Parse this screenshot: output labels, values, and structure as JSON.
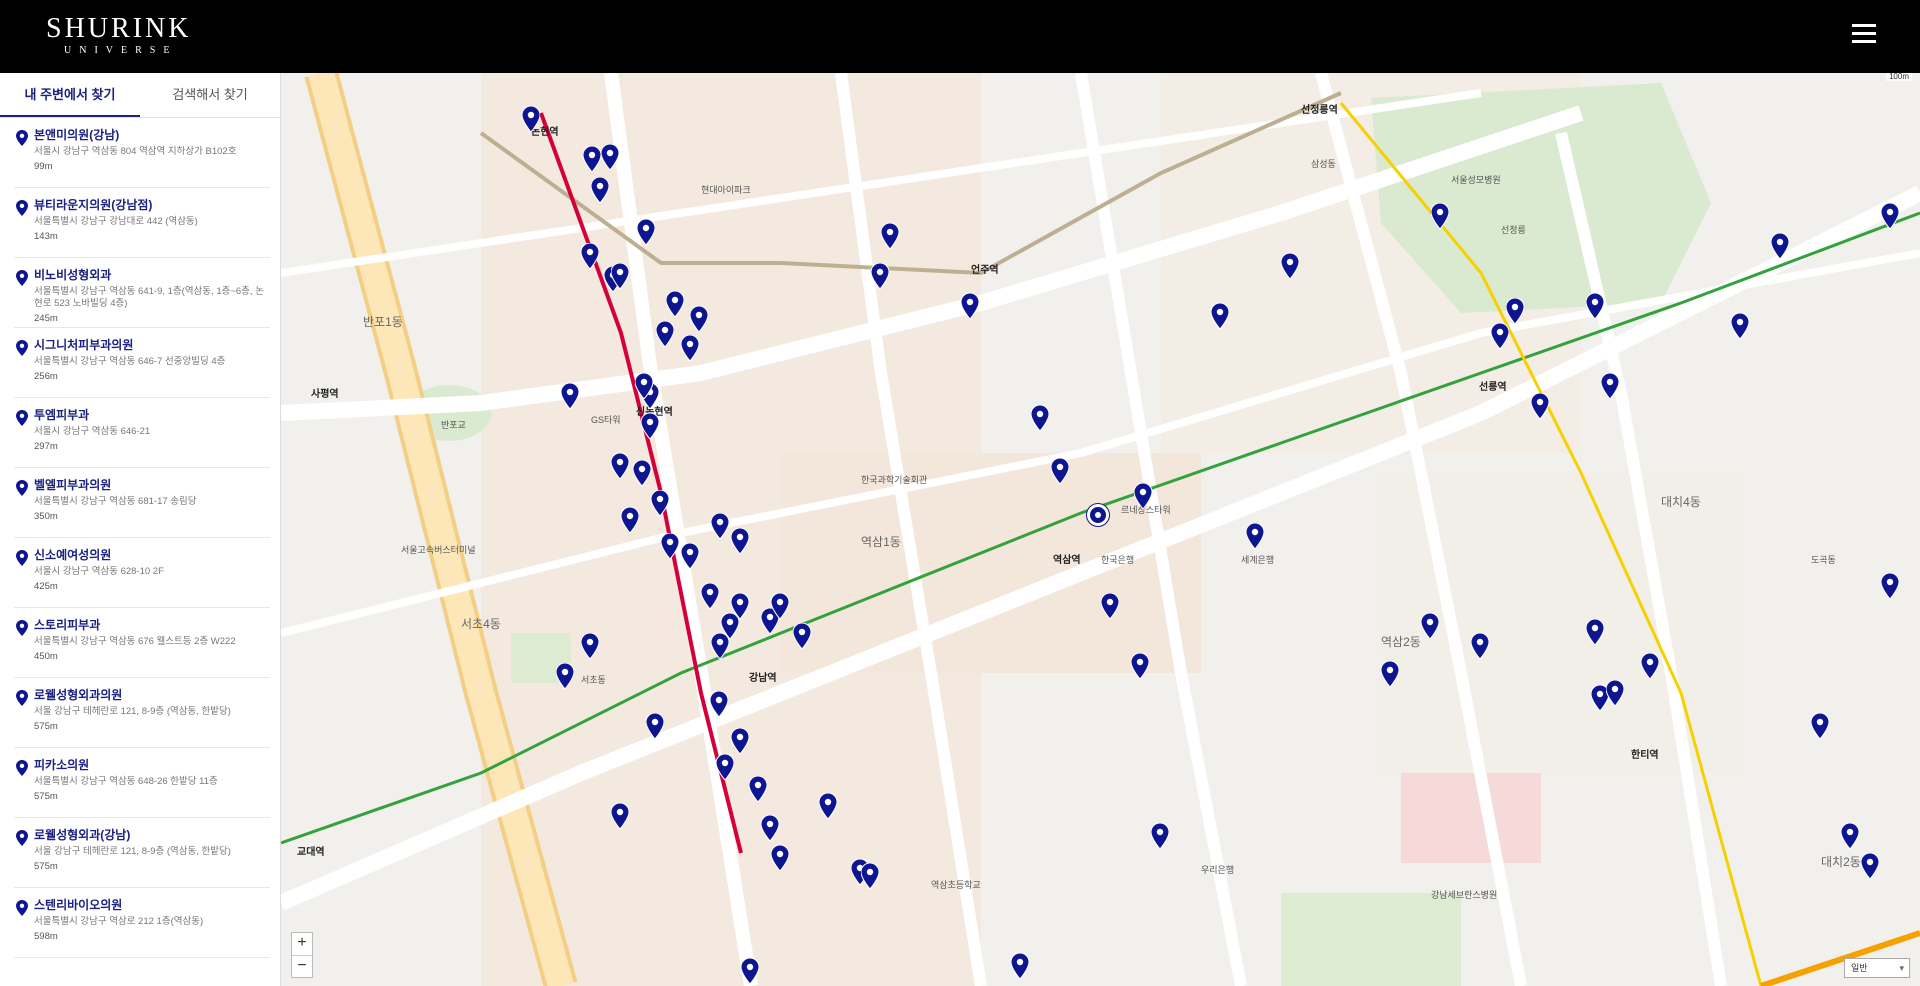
{
  "brand": {
    "name": "SHURINK",
    "sub": "UNIVERSE"
  },
  "tabs": [
    {
      "label": "내 주변에서 찾기",
      "active": true
    },
    {
      "label": "검색해서 찾기",
      "active": false
    }
  ],
  "clinics": [
    {
      "name": "본앤미의원(강남)",
      "address": "서울시 강남구 역삼동 804 역삼역 지하상가 B102호",
      "distance": "99m"
    },
    {
      "name": "뷰티라운지의원(강남점)",
      "address": "서울특별시 강남구 강남대로 442 (역삼동)",
      "distance": "143m"
    },
    {
      "name": "비노비성형외과",
      "address": "서울특별시 강남구 역삼동 641-9, 1층(역삼동, 1층~6층, 논현로 523 노바빌딩 4층)",
      "distance": "245m"
    },
    {
      "name": "시그니처피부과의원",
      "address": "서울특별시 강남구 역삼동 646-7 선중앙빌딩 4층",
      "distance": "256m"
    },
    {
      "name": "투엠피부과",
      "address": "서울시 강남구 역삼동 646-21",
      "distance": "297m"
    },
    {
      "name": "벨엘피부과의원",
      "address": "서울특별시 강남구 역삼동 681-17 송림당",
      "distance": "350m"
    },
    {
      "name": "신소예여성의원",
      "address": "서울시 강남구 역삼동 628-10 2F",
      "distance": "425m"
    },
    {
      "name": "스토리피부과",
      "address": "서울특별시 강남구 역삼동 676 웰스트등 2층 W222",
      "distance": "450m"
    },
    {
      "name": "로웰성형외과의원",
      "address": "서울 강남구 테헤란로 121, 8-9층 (역삼동, 한밭당)",
      "distance": "575m"
    },
    {
      "name": "피카소의원",
      "address": "서울특별시 강남구 역삼동 648-26 한밭당 11층",
      "distance": "575m"
    },
    {
      "name": "로웰성형외과(강남)",
      "address": "서울 강남구 테헤란로 121, 8-9층 (역삼동, 한밭당)",
      "distance": "575m"
    },
    {
      "name": "스텐리바이오의원",
      "address": "서울특별시 강남구 역삼로 212 1층(역삼동)",
      "distance": "598m"
    }
  ],
  "map": {
    "labels": {
      "a1": "반포1동",
      "a2": "서초4동",
      "a3": "역삼1동",
      "a4": "역삼2동",
      "a5": "대치4동",
      "a6": "대치2동",
      "s1": "강남역",
      "s2": "역삼역",
      "s3": "선릉역",
      "s4": "한티역",
      "s5": "신논현역",
      "s6": "논현역",
      "s7": "언주역",
      "s8": "선정릉역",
      "s9": "교대역",
      "s10": "사평역",
      "p1": "르네상스타워",
      "p2": "GS타워",
      "p3": "한국과학기술회관",
      "p4": "현대아이파크",
      "p5": "삼성동",
      "p6": "서초동",
      "p7": "세계은행",
      "p8": "한국은행",
      "p9": "도곡동",
      "p10": "우리은행",
      "p11": "반포교",
      "p12": "서울성모병원",
      "p13": "강남세브란스병원",
      "p14": "선정릉",
      "p15": "역삼초등학교",
      "p16": "서울고속버스터미널"
    },
    "zoom_in": "+",
    "zoom_out": "−",
    "map_type": "일반",
    "scale": "100m"
  },
  "colors": {
    "primary": "#1a2180",
    "marker": "#0d1590",
    "line2": "#33a23d",
    "line9": "#bdb092",
    "shinbundang": "#d4003b",
    "bundang": "#f5a200"
  }
}
